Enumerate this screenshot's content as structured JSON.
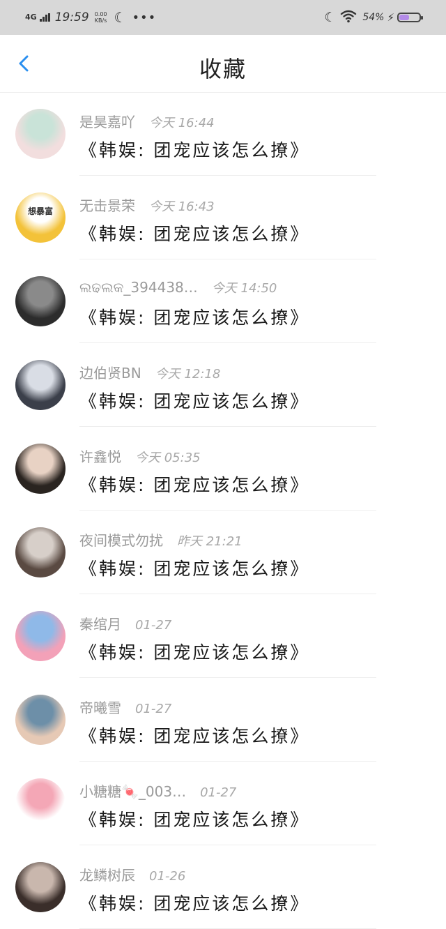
{
  "status_bar": {
    "network": "4G",
    "time": "19:59",
    "speed_value": "0.00",
    "speed_unit": "KB/s",
    "battery": "54%",
    "battery_level": 0.54
  },
  "header": {
    "title": "收藏"
  },
  "items": [
    {
      "name": "是昊嘉吖",
      "time": "今天 16:44",
      "message": "《韩娱: 团宠应该怎么撩》",
      "avatar_color_a": "#f2dede",
      "avatar_color_b": "#c9e3d8"
    },
    {
      "name": "无击景荣",
      "time": "今天 16:43",
      "message": "《韩娱: 团宠应该怎么撩》",
      "avatar_color_a": "#f3c239",
      "avatar_color_b": "#ffffff",
      "avatar_text": "想暴富"
    },
    {
      "name": "ଲଢଲକ_394438…",
      "time": "今天 14:50",
      "message": "《韩娱: 团宠应该怎么撩》",
      "avatar_color_a": "#2c2c2c",
      "avatar_color_b": "#8a8a8a"
    },
    {
      "name": "边伯贤BN",
      "time": "今天 12:18",
      "message": "《韩娱: 团宠应该怎么撩》",
      "avatar_color_a": "#3b3f4a",
      "avatar_color_b": "#d9dde5"
    },
    {
      "name": "许鑫悦",
      "time": "今天 05:35",
      "message": "《韩娱: 团宠应该怎么撩》",
      "avatar_color_a": "#2a2420",
      "avatar_color_b": "#e8d2c4"
    },
    {
      "name": "夜间模式勿扰",
      "time": "昨天 21:21",
      "message": "《韩娱: 团宠应该怎么撩》",
      "avatar_color_a": "#5a4a42",
      "avatar_color_b": "#d7cfc9"
    },
    {
      "name": "秦绾月",
      "time": "01-27",
      "message": "《韩娱: 团宠应该怎么撩》",
      "avatar_color_a": "#f3a1b8",
      "avatar_color_b": "#8fb9e8"
    },
    {
      "name": "帝曦雪",
      "time": "01-27",
      "message": "《韩娱: 团宠应该怎么撩》",
      "avatar_color_a": "#e6c9b5",
      "avatar_color_b": "#6d8fa8"
    },
    {
      "name": "小糖糖🍬_003…",
      "time": "01-27",
      "message": "《韩娱: 团宠应该怎么撩》",
      "avatar_color_a": "#ffffff",
      "avatar_color_b": "#f4a7b6"
    },
    {
      "name": "龙鳞树辰",
      "time": "01-26",
      "message": "《韩娱: 团宠应该怎么撩》",
      "avatar_color_a": "#3a2e2a",
      "avatar_color_b": "#c9b7ad"
    }
  ]
}
